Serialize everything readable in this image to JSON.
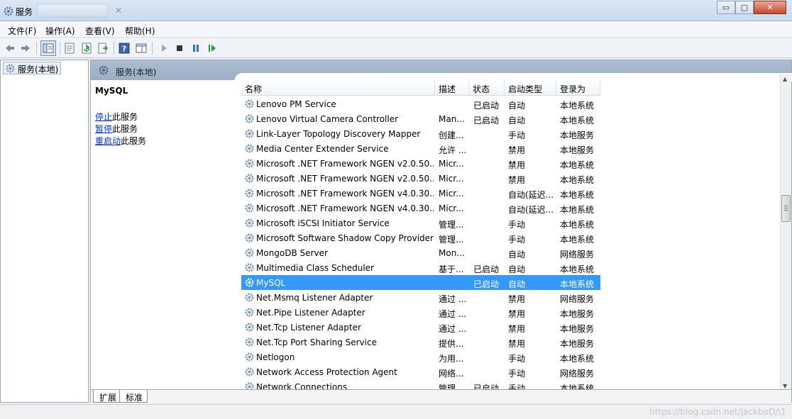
{
  "window": {
    "title": "服务",
    "close_glyph": "✕",
    "minimize_glyph": "▭",
    "maximize_glyph": "▢"
  },
  "menu": [
    "文件(F)",
    "操作(A)",
    "查看(V)",
    "帮助(H)"
  ],
  "toolbar": {
    "icons": [
      "back-arrow-icon",
      "forward-arrow-icon",
      "show-tree-icon",
      "properties-icon",
      "refresh-icon",
      "export-icon",
      "help-icon",
      "show-hide-pane-icon",
      "start-service-icon",
      "stop-service-icon",
      "pause-service-icon",
      "restart-service-icon"
    ]
  },
  "tree": {
    "root_label": "服务(本地)"
  },
  "main_header": {
    "title": "服务(本地)"
  },
  "detail": {
    "service_name": "MySQL",
    "actions": [
      {
        "link": "停止",
        "suffix": "此服务"
      },
      {
        "link": "暂停",
        "suffix": "此服务"
      },
      {
        "link": "重启动",
        "suffix": "此服务"
      }
    ]
  },
  "columns": [
    "名称",
    "描述",
    "状态",
    "启动类型",
    "登录为"
  ],
  "sort_indicator": "˄",
  "rows": [
    {
      "name": "Lenovo PM Service",
      "desc": "",
      "status": "已启动",
      "startup": "自动",
      "logon": "本地系统"
    },
    {
      "name": "Lenovo Virtual Camera Controller",
      "desc": "Man...",
      "status": "已启动",
      "startup": "自动",
      "logon": "本地系统"
    },
    {
      "name": "Link-Layer Topology Discovery Mapper",
      "desc": "创建...",
      "status": "",
      "startup": "手动",
      "logon": "本地服务"
    },
    {
      "name": "Media Center Extender Service",
      "desc": "允许 ...",
      "status": "",
      "startup": "禁用",
      "logon": "本地服务"
    },
    {
      "name": "Microsoft .NET Framework NGEN v2.0.50...",
      "desc": "Micr...",
      "status": "",
      "startup": "禁用",
      "logon": "本地系统"
    },
    {
      "name": "Microsoft .NET Framework NGEN v2.0.50...",
      "desc": "Micr...",
      "status": "",
      "startup": "禁用",
      "logon": "本地系统"
    },
    {
      "name": "Microsoft .NET Framework NGEN v4.0.30...",
      "desc": "Micr...",
      "status": "",
      "startup": "自动(延迟...",
      "logon": "本地系统"
    },
    {
      "name": "Microsoft .NET Framework NGEN v4.0.30...",
      "desc": "Micr...",
      "status": "",
      "startup": "自动(延迟...",
      "logon": "本地系统"
    },
    {
      "name": "Microsoft iSCSI Initiator Service",
      "desc": "管理...",
      "status": "",
      "startup": "手动",
      "logon": "本地系统"
    },
    {
      "name": "Microsoft Software Shadow Copy Provider",
      "desc": "管理...",
      "status": "",
      "startup": "手动",
      "logon": "本地系统"
    },
    {
      "name": "MongoDB Server",
      "desc": "Mon...",
      "status": "",
      "startup": "自动",
      "logon": "网络服务"
    },
    {
      "name": "Multimedia Class Scheduler",
      "desc": "基于...",
      "status": "已启动",
      "startup": "自动",
      "logon": "本地系统"
    },
    {
      "name": "MySQL",
      "desc": "",
      "status": "已启动",
      "startup": "自动",
      "logon": "本地系统",
      "selected": true
    },
    {
      "name": "Net.Msmq Listener Adapter",
      "desc": "通过 ...",
      "status": "",
      "startup": "禁用",
      "logon": "网络服务"
    },
    {
      "name": "Net.Pipe Listener Adapter",
      "desc": "通过 ...",
      "status": "",
      "startup": "禁用",
      "logon": "本地服务"
    },
    {
      "name": "Net.Tcp Listener Adapter",
      "desc": "通过 ...",
      "status": "",
      "startup": "禁用",
      "logon": "本地服务"
    },
    {
      "name": "Net.Tcp Port Sharing Service",
      "desc": "提供...",
      "status": "",
      "startup": "禁用",
      "logon": "本地服务"
    },
    {
      "name": "Netlogon",
      "desc": "为用...",
      "status": "",
      "startup": "手动",
      "logon": "本地系统"
    },
    {
      "name": "Network Access Protection Agent",
      "desc": "网络...",
      "status": "",
      "startup": "手动",
      "logon": "网络服务"
    },
    {
      "name": "Network Connections",
      "desc": "管理...",
      "status": "已启动",
      "startup": "手动",
      "logon": "本地系统"
    }
  ],
  "bottom_tabs": [
    "扩展",
    "标准"
  ],
  "watermark": "https://blog.csdn.net/JackboD/\\1",
  "colors": {
    "selection": "#3399ff",
    "link": "#0033cc",
    "header": "#9caec4"
  }
}
